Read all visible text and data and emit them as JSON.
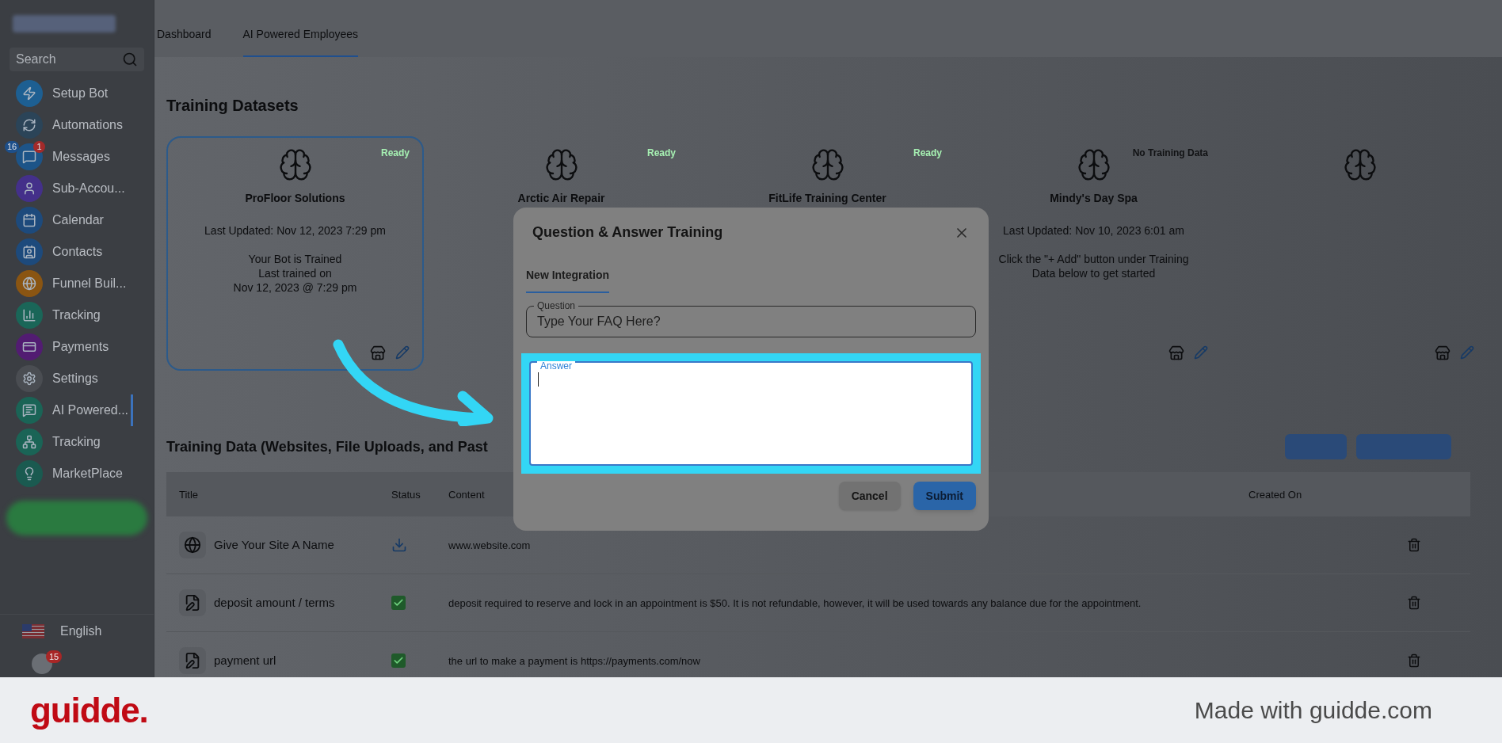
{
  "sidebar": {
    "search": {
      "placeholder": "Search"
    },
    "items": [
      {
        "label": "Setup Bot",
        "color": "#1d5f92",
        "selected": false
      },
      {
        "label": "Automations",
        "color": "#2b4458",
        "selected": false
      },
      {
        "label": "Messages",
        "color": "#1d5488",
        "selected": false,
        "badges": [
          {
            "text": "16",
            "color": "#1d4f8a"
          },
          {
            "text": "1",
            "color": "#a32a2a"
          }
        ]
      },
      {
        "label": "Sub-Accou...",
        "color": "#44308a",
        "selected": false
      },
      {
        "label": "Calendar",
        "color": "#1d4a7c",
        "selected": false
      },
      {
        "label": "Contacts",
        "color": "#1d4a7c",
        "selected": false
      },
      {
        "label": "Funnel Buil...",
        "color": "#8a5512",
        "selected": false
      },
      {
        "label": "Tracking",
        "color": "#1a6658",
        "selected": false
      },
      {
        "label": "Payments",
        "color": "#521c72",
        "selected": false
      },
      {
        "label": "Settings",
        "color": "#4a4d52",
        "selected": false
      },
      {
        "label": "AI Powered...",
        "color": "#1a6456",
        "selected": true
      },
      {
        "label": "Tracking",
        "color": "#1a6456",
        "selected": false
      },
      {
        "label": "MarketPlace",
        "color": "#1a5a50",
        "selected": false
      }
    ],
    "language": "English",
    "notification_badge": "15"
  },
  "top_tabs": [
    {
      "label": "Dashboard",
      "selected": false
    },
    {
      "label": "AI Powered Employees",
      "selected": true
    }
  ],
  "datasets": {
    "title": "Training Datasets",
    "cards": [
      {
        "name": "ProFloor Solutions",
        "status": {
          "text": "Ready",
          "color": "#a6f0b2"
        },
        "selected": true,
        "lines": [
          "Last Updated: Nov 12, 2023 7:29 pm"
        ],
        "note": [
          "Your Bot is Trained",
          "Last trained on",
          "Nov 12, 2023 @ 7:29 pm"
        ],
        "actions": true
      },
      {
        "name": "Arctic Air Repair",
        "status": {
          "text": "Ready",
          "color": "#a6f0b2"
        },
        "selected": false,
        "actions": false
      },
      {
        "name": "FitLife Training Center",
        "status": {
          "text": "Ready",
          "color": "#a6f0b2"
        },
        "selected": false,
        "actions": false
      },
      {
        "name": "Mindy's Day Spa",
        "status": {
          "text": "No Training Data",
          "color": "#111214"
        },
        "selected": false,
        "lines": [
          "Last Updated: Nov 10, 2023 6:01 am"
        ],
        "note": [
          "Click the \"+ Add\" button under Training Data below to get started"
        ],
        "actions": true
      },
      {
        "selected": false,
        "actions": true
      }
    ]
  },
  "training_data": {
    "title": "Training Data (Websites, File Uploads, and Past",
    "columns": [
      "Title",
      "Status",
      "Content",
      "Created On"
    ],
    "rows": [
      {
        "title": "Give Your Site A Name",
        "kind": "website",
        "done": false,
        "content": "www.website.com"
      },
      {
        "title": "deposit amount / terms",
        "kind": "text",
        "done": true,
        "content": "deposit required to reserve and lock in an appointment is $50. It is not refundable, however, it will be used towards any balance due for the appointment."
      },
      {
        "title": "payment url",
        "kind": "text",
        "done": true,
        "content": "the url to make a payment is https://payments.com/now"
      }
    ]
  },
  "dialog": {
    "title": "Question & Answer Training",
    "tabs": [
      {
        "label": "New Integration",
        "selected": true
      }
    ],
    "question": {
      "label": "Question",
      "placeholder": "Type Your FAQ Here?"
    },
    "answer": {
      "label": "Answer",
      "focused": true,
      "highlighted": true
    },
    "buttons": [
      {
        "label": "Cancel",
        "kind": "secondary"
      },
      {
        "label": "Submit",
        "kind": "primary"
      }
    ]
  },
  "footer": {
    "logo": "guidde.",
    "text": "Made with guidde.com"
  }
}
